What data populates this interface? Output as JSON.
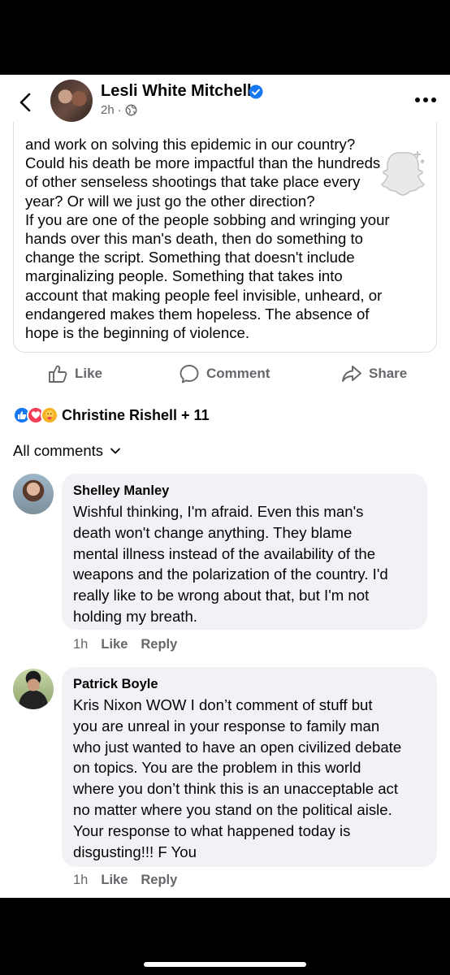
{
  "post": {
    "author": "Lesli White Mitchell",
    "time": "2h",
    "separator": "·",
    "lines": [
      "and work on solving this epidemic in our country?",
      "Could his death be more impactful than the hundreds",
      "of other senseless shootings that take place every",
      "year? Or will we just go the other direction?",
      "If you are one of the people sobbing and wringing your",
      "hands over this man's death, then do something to",
      "change the script. Something that doesn't include",
      "marginalizing people. Something that takes into",
      "account that making people feel invisible, unheard, or",
      "endangered makes them hopeless. The absence of",
      "hope is the beginning of violence."
    ]
  },
  "actions": {
    "like": "Like",
    "comment": "Comment",
    "share": "Share"
  },
  "reactions": {
    "text": "Christine Rishell + 11"
  },
  "comments_header": "All comments",
  "comments": [
    {
      "name": "Shelley Manley",
      "lines": [
        "Wishful thinking, I'm afraid. Even this man's",
        "death won't change anything. They blame",
        "mental illness instead of the availability of the",
        "weapons and the polarization of the country. I'd",
        "really like to be wrong about that, but I'm not",
        "holding my breath."
      ],
      "time": "1h",
      "like": "Like",
      "reply": "Reply"
    },
    {
      "name": "Patrick Boyle",
      "lines": [
        "Kris Nixon WOW I don’t comment of stuff but",
        "you are unreal in your response to family man",
        "who just wanted to have an open civilized debate",
        "on topics. You are the problem in this world",
        "where you don’t think this is an unacceptable act",
        "no matter where you stand on the political aisle.",
        "Your response to what happened today is",
        "disgusting!!! F You"
      ],
      "time": "1h",
      "like": "Like",
      "reply": "Reply"
    }
  ],
  "colors": {
    "accent": "#1877f2",
    "bubble": "#f0f2f5",
    "muted": "#65676b"
  },
  "icons": [
    "back-chevron-icon",
    "verified-badge-icon",
    "globe-icon",
    "more-dots-icon",
    "snapchat-ghost-icon",
    "thumbs-up-icon",
    "comment-bubble-icon",
    "share-arrow-icon",
    "chevron-down-icon"
  ]
}
